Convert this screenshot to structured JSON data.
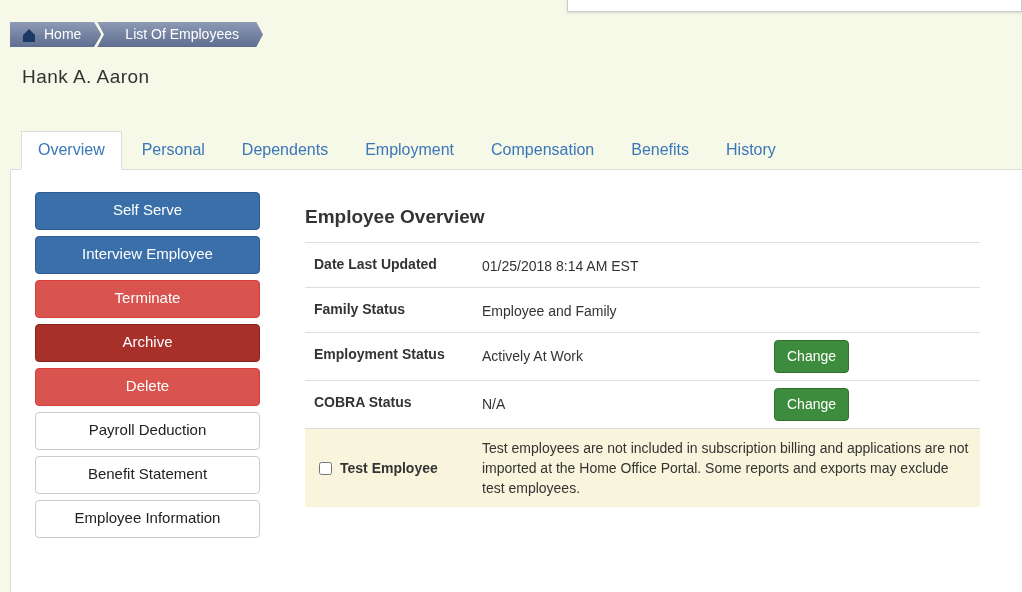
{
  "breadcrumb": [
    {
      "label": "Home",
      "kind": "home"
    },
    {
      "label": "List Of Employees",
      "kind": "link"
    }
  ],
  "employee_name": "Hank A. Aaron",
  "tabs": [
    {
      "label": "Overview",
      "selected": true
    },
    {
      "label": "Personal",
      "selected": false
    },
    {
      "label": "Dependents",
      "selected": false
    },
    {
      "label": "Employment",
      "selected": false
    },
    {
      "label": "Compensation",
      "selected": false
    },
    {
      "label": "Benefits",
      "selected": false
    },
    {
      "label": "History",
      "selected": false
    }
  ],
  "actions": [
    {
      "label": "Self Serve",
      "kind": "primary"
    },
    {
      "label": "Interview Employee",
      "kind": "primary"
    },
    {
      "label": "Terminate",
      "kind": "danger"
    },
    {
      "label": "Archive",
      "kind": "dark"
    },
    {
      "label": "Delete",
      "kind": "danger"
    },
    {
      "label": "Payroll Deduction",
      "kind": "default"
    },
    {
      "label": "Benefit Statement",
      "kind": "default"
    },
    {
      "label": "Employee Information",
      "kind": "default"
    }
  ],
  "overview": {
    "title": "Employee Overview",
    "rows": [
      {
        "label": "Date Last Updated",
        "value": "01/25/2018 8:14 AM EST"
      },
      {
        "label": "Family Status",
        "value": "Employee and Family"
      },
      {
        "label": "Employment Status",
        "value": "Actively At Work",
        "button": "Change"
      },
      {
        "label": "COBRA Status",
        "value": "N/A",
        "button": "Change"
      }
    ],
    "test_employee": {
      "label": "Test Employee",
      "checked": false,
      "note": "Test employees are not included in subscription billing and applications are not imported at the Home Office Portal. Some reports and exports may exclude test employees."
    }
  }
}
